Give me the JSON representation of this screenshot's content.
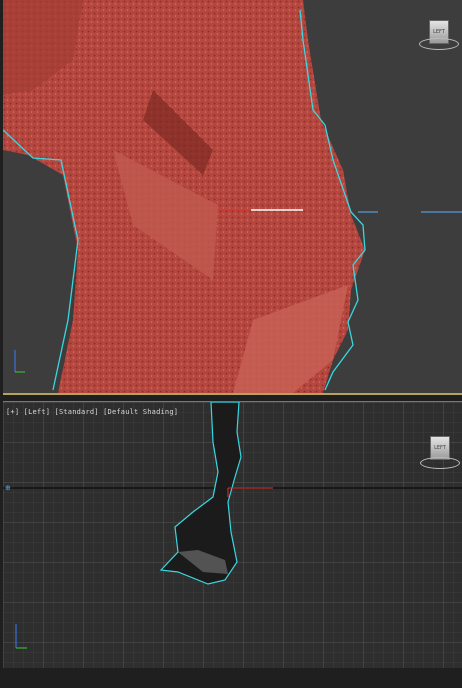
{
  "viewports": {
    "top": {
      "cube_label": "LEFT",
      "background": "#3d3d3d",
      "mesh_color": "#b5473e",
      "selection_outline_color": "#3ad6e0"
    },
    "bottom": {
      "label": "[+] [Left] [Standard] [Default Shading]",
      "cube_label": "LEFT",
      "background": "#2e2e2e",
      "grid_color": "#4a4a4a"
    }
  },
  "icons": [
    "viewcube-icon",
    "axis-tripod-icon",
    "transform-gizmo-icon"
  ]
}
